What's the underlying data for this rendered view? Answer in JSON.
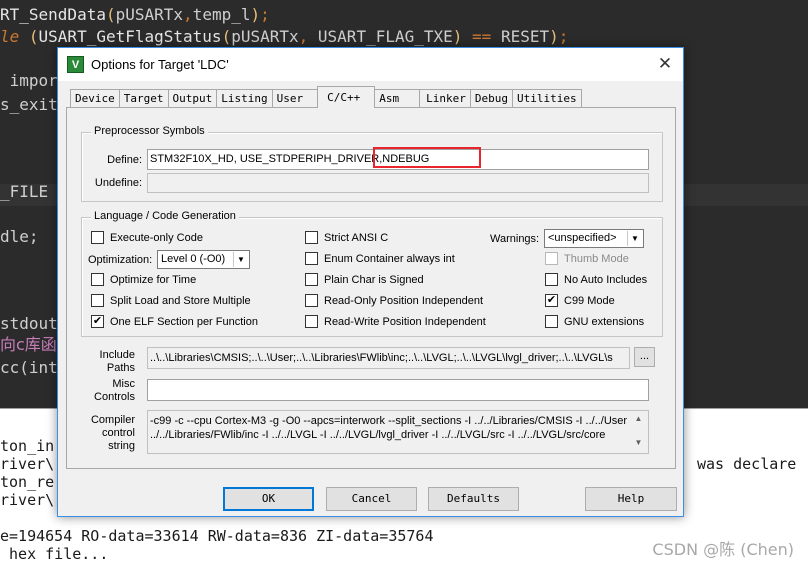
{
  "editor": {
    "lines": [
      {
        "fn": "RT_SendData",
        "p1": "(",
        "arg1": "pUSARTx",
        "sep": ",",
        "arg2": "temp_l",
        "p2": ")",
        "end": ";"
      },
      {
        "kw": "le",
        "open": " (",
        "fn": "USART_GetFlagStatus",
        "p1": "(",
        "arg1": "pUSARTx",
        "sep": ", ",
        "arg2": "USART_FLAG_TXE",
        "p2": ")",
        "op": " == ",
        "cn": "RESET",
        "p3": ")",
        "end": ";"
      },
      {
        "text": " impor"
      },
      {
        "text": "s_exit"
      },
      {
        "text": "_FILE"
      },
      {
        "text": "dle;"
      },
      {
        "text": "stdout"
      },
      {
        "text": "向c库函"
      },
      {
        "text": "cc(int"
      }
    ]
  },
  "output": {
    "lines": [
      "ton_in",
      "river\\",
      "ton_re",
      "river\\",
      "e=194654 RO-data=33614 RW-data=836 ZI-data=35764",
      " hex file..."
    ],
    "right_text": "was declare"
  },
  "watermark": "CSDN @陈 (Chen)",
  "dialog": {
    "title": "Options for Target 'LDC'",
    "icon_glyph": "V",
    "tabs": [
      "Device",
      "Target",
      "Output",
      "Listing",
      "User",
      "C/C++",
      "Asm",
      "Linker",
      "Debug",
      "Utilities"
    ],
    "active_tab": "C/C++",
    "preprocessor": {
      "group_label": "Preprocessor Symbols",
      "define_label": "Define:",
      "define_value": "STM32F10X_HD, USE_STDPERIPH_DRIVER,NDEBUG",
      "undefine_label": "Undefine:",
      "undefine_value": ""
    },
    "language": {
      "group_label": "Language / Code Generation",
      "col1": [
        {
          "label": "Execute-only Code",
          "checked": false
        },
        {
          "label": "Optimize for Time",
          "checked": false
        },
        {
          "label": "Split Load and Store Multiple",
          "checked": false
        },
        {
          "label": "One ELF Section per Function",
          "checked": true
        }
      ],
      "optimization_label": "Optimization:",
      "optimization_value": "Level 0 (-O0)",
      "col2": [
        {
          "label": "Strict ANSI C",
          "checked": false
        },
        {
          "label": "Enum Container always int",
          "checked": false
        },
        {
          "label": "Plain Char is Signed",
          "checked": false
        },
        {
          "label": "Read-Only Position Independent",
          "checked": false
        },
        {
          "label": "Read-Write Position Independent",
          "checked": false
        }
      ],
      "warnings_label": "Warnings:",
      "warnings_value": "<unspecified>",
      "col3": [
        {
          "label": "Thumb Mode",
          "checked": false,
          "disabled": true
        },
        {
          "label": "No Auto Includes",
          "checked": false
        },
        {
          "label": "C99 Mode",
          "checked": true
        },
        {
          "label": "GNU extensions",
          "checked": false
        }
      ]
    },
    "include_paths_label_1": "Include",
    "include_paths_label_2": "Paths",
    "include_paths_value": "..\\..\\Libraries\\CMSIS;..\\..\\User;..\\..\\Libraries\\FWlib\\inc;..\\..\\LVGL;..\\..\\LVGL\\lvgl_driver;..\\..\\LVGL\\s",
    "browse_label": "...",
    "misc_label_1": "Misc",
    "misc_label_2": "Controls",
    "misc_value": "",
    "compiler_label_1": "Compiler",
    "compiler_label_2": "control",
    "compiler_label_3": "string",
    "compiler_line_1": "-c99 -c --cpu Cortex-M3 -g -O0 --apcs=interwork --split_sections -I ../../Libraries/CMSIS -I ../../User -I",
    "compiler_line_2": "../../Libraries/FWlib/inc -I ../../LVGL -I ../../LVGL/lvgl_driver -I ../../LVGL/src -I ../../LVGL/src/core",
    "buttons": {
      "ok": "OK",
      "cancel": "Cancel",
      "defaults": "Defaults",
      "help": "Help"
    }
  }
}
